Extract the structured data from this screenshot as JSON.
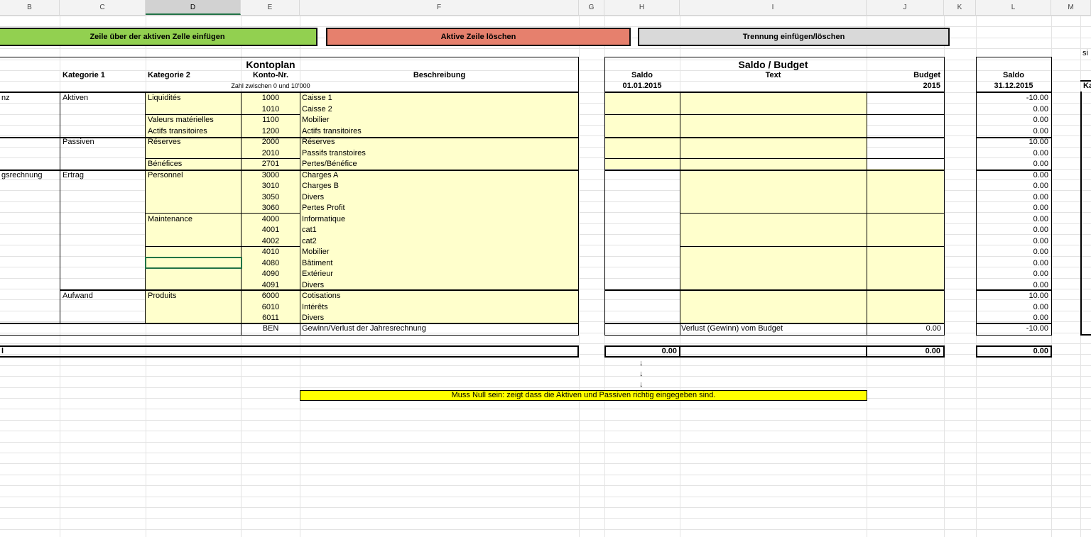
{
  "columns": [
    "B",
    "C",
    "D",
    "E",
    "F",
    "G",
    "H",
    "I",
    "J",
    "K",
    "L",
    "M"
  ],
  "selected_column": "D",
  "buttons": {
    "insert_row": "Zeile über der aktiven Zelle einfügen",
    "delete_row": "Aktive Zeile löschen",
    "separator": "Trennung einfügen/löschen"
  },
  "colors": {
    "insert_button": "#92d050",
    "delete_button": "#e6806d",
    "separator_button": "#d9d9d9",
    "input_cells": "#ffffcc",
    "note_bar": "#ffff00",
    "active_cell": "#217346"
  },
  "kontoplan": {
    "title": "Kontoplan",
    "col_cat1": "Kategorie 1",
    "col_cat2": "Kategorie 2",
    "col_konto": "Konto-Nr.",
    "col_desc": "Beschreibung",
    "konto_hint": "Zahl zwischen 0 und 10'000"
  },
  "saldo_budget": {
    "title": "Saldo / Budget",
    "col_saldo": "Saldo",
    "col_saldo_date": "01.01.2015",
    "col_text": "Text",
    "col_budget": "Budget",
    "col_budget_year": "2015"
  },
  "saldo_end": {
    "col_saldo": "Saldo",
    "col_saldo_date": "31.12.2015"
  },
  "clipped": {
    "m_top": "si",
    "m_header": "Ka"
  },
  "rows": [
    {
      "b": "nz",
      "c": "Aktiven",
      "d": "Liquidités",
      "e": "1000",
      "f": "Caisse 1",
      "l": "-10.00"
    },
    {
      "b": "",
      "c": "",
      "d": "",
      "e": "1010",
      "f": "Caisse 2",
      "l": "0.00"
    },
    {
      "b": "",
      "c": "",
      "d": "Valeurs matérielles",
      "e": "1100",
      "f": "Mobilier",
      "l": "0.00"
    },
    {
      "b": "",
      "c": "",
      "d": "Actifs transitoires",
      "e": "1200",
      "f": "Actifs transitoires",
      "l": "0.00"
    },
    {
      "b": "",
      "c": "Passiven",
      "d": "Réserves",
      "e": "2000",
      "f": "Réserves",
      "l": "10.00"
    },
    {
      "b": "",
      "c": "",
      "d": "",
      "e": "2010",
      "f": "Passifs transtoires",
      "l": "0.00"
    },
    {
      "b": "",
      "c": "",
      "d": "Bénéfices",
      "e": "2701",
      "f": "Pertes/Bénéfice",
      "l": "0.00"
    },
    {
      "b": "gsrechnung",
      "c": "Ertrag",
      "d": "Personnel",
      "e": "3000",
      "f": "Charges A",
      "l": "0.00"
    },
    {
      "b": "",
      "c": "",
      "d": "",
      "e": "3010",
      "f": "Charges B",
      "l": "0.00"
    },
    {
      "b": "",
      "c": "",
      "d": "",
      "e": "3050",
      "f": "Divers",
      "l": "0.00"
    },
    {
      "b": "",
      "c": "",
      "d": "",
      "e": "3060",
      "f": "Pertes Profit",
      "l": "0.00"
    },
    {
      "b": "",
      "c": "",
      "d": "Maintenance",
      "e": "4000",
      "f": "Informatique",
      "l": "0.00"
    },
    {
      "b": "",
      "c": "",
      "d": "",
      "e": "4001",
      "f": "cat1",
      "l": "0.00"
    },
    {
      "b": "",
      "c": "",
      "d": "",
      "e": "4002",
      "f": "cat2",
      "l": "0.00"
    },
    {
      "b": "",
      "c": "",
      "d": "",
      "e": "4010",
      "f": "Mobilier",
      "l": "0.00"
    },
    {
      "b": "",
      "c": "",
      "d": "",
      "e": "4080",
      "f": "Bâtiment",
      "l": "0.00"
    },
    {
      "b": "",
      "c": "",
      "d": "",
      "e": "4090",
      "f": "Extérieur",
      "l": "0.00"
    },
    {
      "b": "",
      "c": "",
      "d": "",
      "e": "4091",
      "f": "Divers",
      "l": "0.00"
    },
    {
      "b": "",
      "c": "Aufwand",
      "d": "Produits",
      "e": "6000",
      "f": "Cotisations",
      "l": "10.00"
    },
    {
      "b": "",
      "c": "",
      "d": "",
      "e": "6010",
      "f": "Intérêts",
      "l": "0.00"
    },
    {
      "b": "",
      "c": "",
      "d": "",
      "e": "6011",
      "f": "Divers",
      "l": "0.00"
    }
  ],
  "ben_row": {
    "e": "BEN",
    "f": "Gewinn/Verlust der Jahresrechnung",
    "i": "Verlust (Gewinn) vom Budget",
    "j": "0.00",
    "l": "-10.00"
  },
  "total_row": {
    "b": "l",
    "h": "0.00",
    "j": "0.00",
    "l": "0.00"
  },
  "arrows": [
    "↓",
    "↓",
    "↓"
  ],
  "note": "Muss Null sein: zeigt dass  die Aktiven und Passiven richtig eingegeben sind."
}
